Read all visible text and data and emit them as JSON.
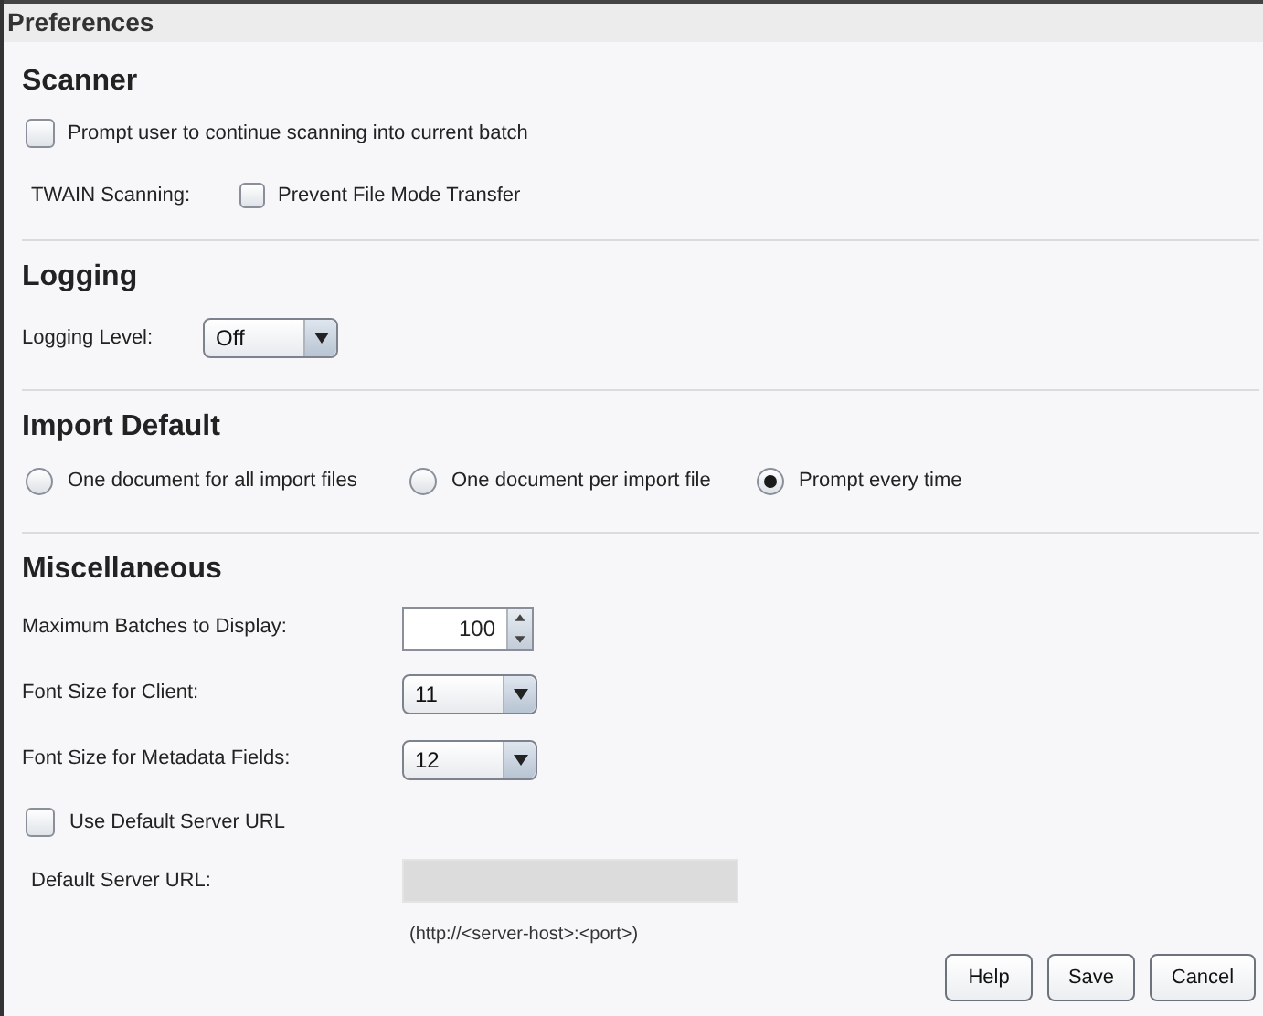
{
  "window": {
    "title": "Preferences"
  },
  "scanner": {
    "heading": "Scanner",
    "prompt_checkbox": {
      "label": "Prompt user to continue scanning into current batch",
      "checked": false
    },
    "twain_label": "TWAIN Scanning:",
    "twain_checkbox": {
      "label": "Prevent File Mode Transfer",
      "checked": false
    }
  },
  "logging": {
    "heading": "Logging",
    "level_label": "Logging Level:",
    "level_value": "Off"
  },
  "import_default": {
    "heading": "Import Default",
    "options": [
      {
        "label": "One document for all import files",
        "selected": false
      },
      {
        "label": "One document per import file",
        "selected": false
      },
      {
        "label": "Prompt every time",
        "selected": true
      }
    ]
  },
  "miscellaneous": {
    "heading": "Miscellaneous",
    "max_batches_label": "Maximum Batches to Display:",
    "max_batches_value": "100",
    "client_font_label": "Font Size for Client:",
    "client_font_value": "11",
    "metadata_font_label": "Font Size for Metadata Fields:",
    "metadata_font_value": "12",
    "use_default_url": {
      "label": "Use Default Server URL",
      "checked": false
    },
    "server_url_label": "Default Server URL:",
    "server_url_hint": "(http://<server-host>:<port>)"
  },
  "buttons": [
    "Help",
    "Save",
    "Cancel"
  ]
}
